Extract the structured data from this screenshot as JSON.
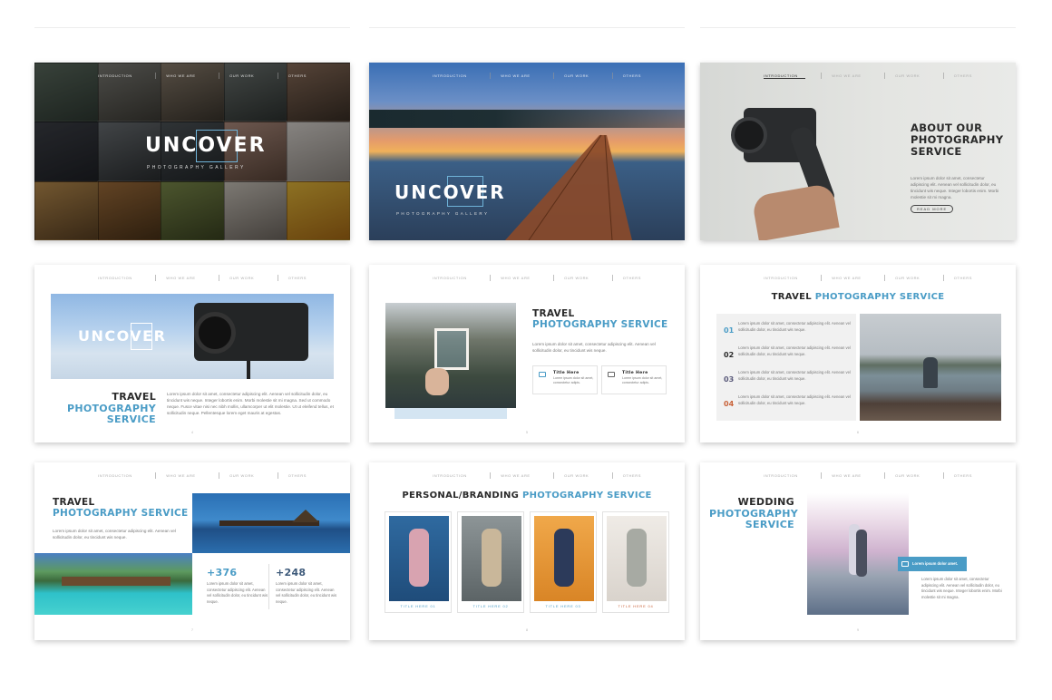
{
  "nav": [
    "Introduction",
    "Who we are",
    "Our Work",
    "Others"
  ],
  "brand": "UNCOVER",
  "subtitle": "PHOTOGRAPHY GALLERY",
  "lorem_short": "Lorem ipsum dolor sit amet, consectetur adipiscing elit. Aenean vel sollicitudin dolor, eu tincidunt wis neque. Integer lobortis enim. Morbi molestie sit mi magna.",
  "lorem_tiny": "Lorem ipsum dolor sit amet, consectetur adipiscing elit. Aenean vel sollicitudin dolor, eu tincidunt wis neque.",
  "slide3": {
    "title": "ABOUT OUR PHOTOGRAPHY SERVICE",
    "read_more": "READ MORE"
  },
  "slide4": {
    "title_dark": "TRAVEL",
    "title_blue": "PHOTOGRAPHY",
    "title_line2": "SERVICE",
    "body": "Lorem ipsum dolor sit amet, consectetur adipiscing elit. Aenean vel sollicitudin dolor, eu tincidunt wis neque. Integer lobortis enim. Morbi molestie sit mi magna. Sed ut commodo neque. Fusce vitae nisi nec nibh mollis, ullamcorper ut elit molestie. Ut ut eleifend tellus, et sollicitudin neque. Pellentesque lorem eget mauris at egestas."
  },
  "slide5": {
    "title_dark": "TRAVEL",
    "title_blue": "PHOTOGRAPHY SERVICE",
    "body": "Lorem ipsum dolor sit amet, consectetur adipiscing elit. Aenean vel sollicitudin dolor, eu tincidunt wis neque.",
    "box1_title": "Title Here",
    "box1_body": "Lorem ipsum dolor sit amet, consectetur adipis.",
    "box2_title": "Title Here",
    "box2_body": "Lorem ipsum dolor sit amet, consectetur adipis."
  },
  "slide6": {
    "title_dark": "TRAVEL",
    "title_blue": "PHOTOGRAPHY SERVICE",
    "items": [
      {
        "num": "01",
        "text": "Lorem ipsum dolor sit amet, consectetur adipiscing elit. Aenean vel sollicitudin dolor, eu tincidunt wis neque."
      },
      {
        "num": "02",
        "text": "Lorem ipsum dolor sit amet, consectetur adipiscing elit. Aenean vel sollicitudin dolor, eu tincidunt wis neque."
      },
      {
        "num": "03",
        "text": "Lorem ipsum dolor sit amet, consectetur adipiscing elit. Aenean vel sollicitudin dolor, eu tincidunt wis neque."
      },
      {
        "num": "04",
        "text": "Lorem ipsum dolor sit amet, consectetur adipiscing elit. Aenean vel sollicitudin dolor, eu tincidunt wis neque."
      }
    ]
  },
  "slide7": {
    "title_dark": "TRAVEL",
    "title_blue": "PHOTOGRAPHY SERVICE",
    "body": "Lorem ipsum dolor sit amet, consectetur adipiscing elit. Aenean vel sollicitudin dolor, eu tincidunt wis neque.",
    "stat1": "+376",
    "stat1_body": "Lorem ipsum dolor sit amet, consectetur adipiscing elit. Aenean vel sollicitudin dolor, eu tincidunt wis neque.",
    "stat2": "+248",
    "stat2_body": "Lorem ipsum dolor sit amet, consectetur adipiscing elit. Aenean vel sollicitudin dolor, eu tincidunt wis neque."
  },
  "slide8": {
    "title_dark": "PERSONAL/BRANDING",
    "title_blue": "PHOTOGRAPHY SERVICE",
    "cards": [
      "TITLE HERE 01",
      "TITLE HERE 02",
      "TITLE HERE 03",
      "TITLE HERE 04"
    ]
  },
  "slide9": {
    "title_dark": "WEDDING",
    "title_blue_1": "PHOTOGRAPHY",
    "title_blue_2": "SERVICE",
    "tag": "Lorem ipsum dolor amet.",
    "body": "Lorem ipsum dolor sit amet, consectetur adipiscing elit. Aenean vel sollicitudin dolor, eu tincidunt wis neque. Integer lobortis enim. Morbi molestie sit mi magna."
  },
  "page_numbers": [
    "4",
    "5",
    "6",
    "7",
    "8",
    "9"
  ],
  "colors": {
    "accent": "#4a9cc6",
    "dark": "#2a2a2a"
  }
}
